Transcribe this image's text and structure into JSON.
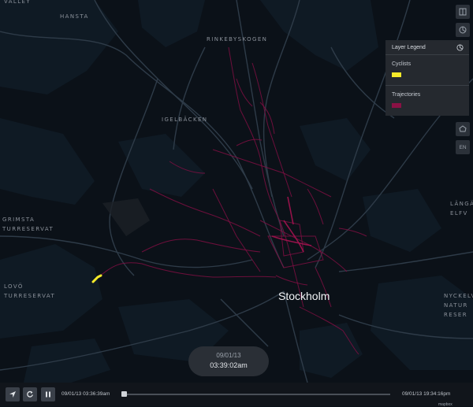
{
  "map": {
    "places": [
      {
        "key": "valley",
        "text": "VALLEY"
      },
      {
        "key": "hansta",
        "text": "HANSTA"
      },
      {
        "key": "rinkeby",
        "text": "RINKEBYSKOGEN"
      },
      {
        "key": "igel",
        "text": "IGELBÄCKEN"
      },
      {
        "key": "grimsta",
        "text": "GRIMSTA\nTURRESERVAT"
      },
      {
        "key": "lovo",
        "text": "LOVÖ\nTURRESERVAT"
      },
      {
        "key": "langa",
        "text": "LÄNGÄ\nELFV"
      },
      {
        "key": "nacka",
        "text": "NYCKELV\nNATUR\nRESER"
      }
    ],
    "city": "Stockholm"
  },
  "toolbar": {
    "top_icon": "map-panel-icon",
    "layers_icon": "layers-icon",
    "draw_icon": "polygon-draw-icon",
    "locale": "EN"
  },
  "legend": {
    "title": "Layer Legend",
    "items": [
      {
        "label": "Cyclists",
        "color": "#f6ea2a"
      },
      {
        "label": "Trajectories",
        "color": "#8a1145"
      }
    ]
  },
  "playback": {
    "current_date": "09/01/13",
    "current_time": "03:39:02am",
    "start": "09/01/13 03:36:39am",
    "end": "09/01/13 19:34:16pm",
    "progress": 0.0
  },
  "footer": {
    "brand": "mapbox"
  }
}
